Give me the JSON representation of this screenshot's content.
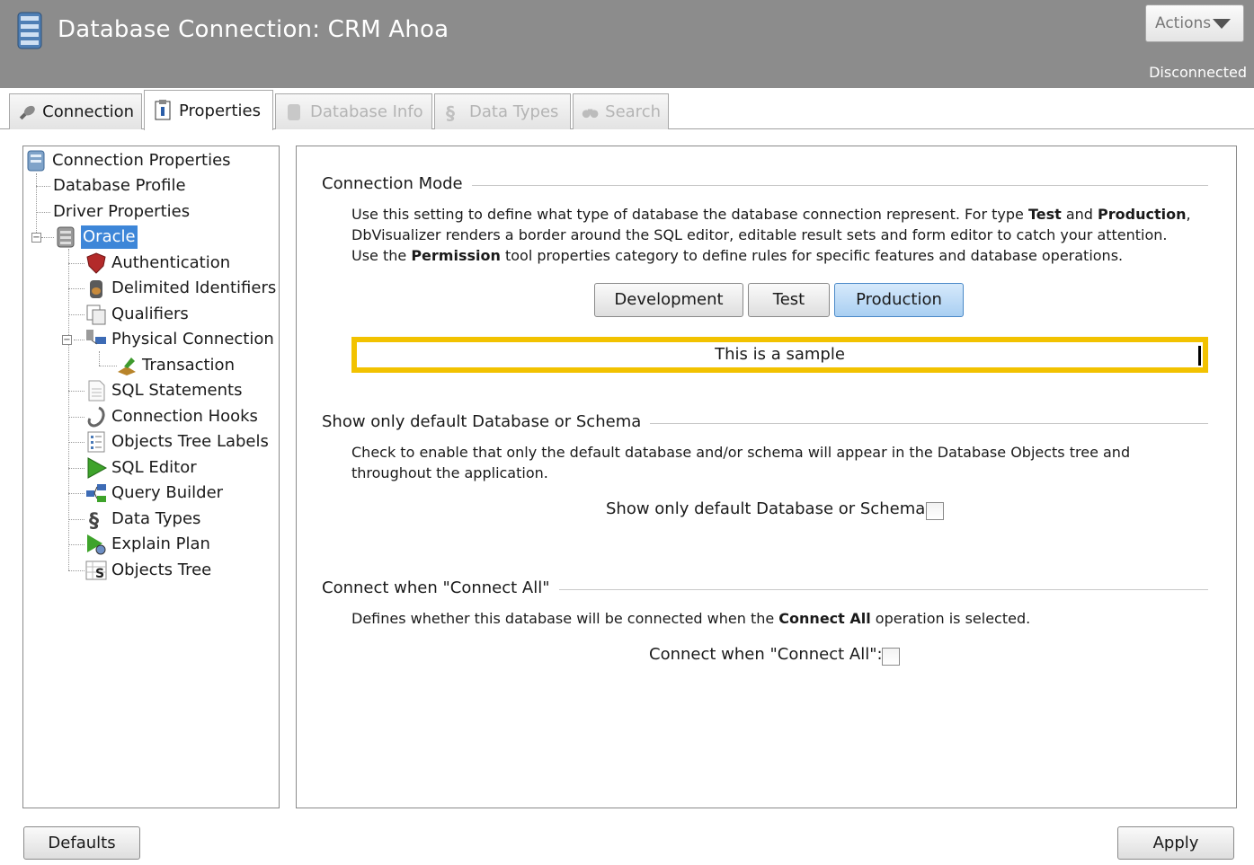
{
  "header": {
    "title": "Database Connection: CRM Ahoa",
    "actions_label": "Actions",
    "status": "Disconnected"
  },
  "tabs": [
    {
      "label": "Connection",
      "icon": "plug-icon",
      "state": "normal"
    },
    {
      "label": "Properties",
      "icon": "properties-icon",
      "state": "active"
    },
    {
      "label": "Database Info",
      "icon": "database-info-icon",
      "state": "disabled"
    },
    {
      "label": "Data Types",
      "icon": "data-types-icon",
      "state": "disabled"
    },
    {
      "label": "Search",
      "icon": "binoculars-icon",
      "state": "disabled"
    }
  ],
  "tree": {
    "root": "Connection Properties",
    "database_profile": "Database Profile",
    "driver_properties": "Driver Properties",
    "oracle": "Oracle",
    "authentication": "Authentication",
    "delimited_identifiers": "Delimited Identifiers",
    "qualifiers": "Qualifiers",
    "physical_connection": "Physical Connection",
    "transaction": "Transaction",
    "sql_statements": "SQL Statements",
    "connection_hooks": "Connection Hooks",
    "objects_tree_labels": "Objects Tree Labels",
    "sql_editor": "SQL Editor",
    "query_builder": "Query Builder",
    "data_types": "Data Types",
    "explain_plan": "Explain Plan",
    "objects_tree": "Objects Tree"
  },
  "connection_mode": {
    "title": "Connection Mode",
    "desc_1a": "Use this setting to define what type of database the database connection represent. For type ",
    "desc_1b": "Test",
    "desc_1c": " and ",
    "desc_1d": "Production",
    "desc_1e": ",",
    "desc_2": "DbVisualizer renders a border around the SQL editor, editable result sets and form editor to catch your attention.",
    "desc_3a": "Use the ",
    "desc_3b": "Permission",
    "desc_3c": " tool properties category to define rules for specific features and database operations.",
    "buttons": [
      "Development",
      "Test",
      "Production"
    ],
    "selected": "Production",
    "sample_text": "This is a sample"
  },
  "show_default": {
    "title": "Show only default Database or Schema",
    "desc": "Check to enable that only the default database and/or schema will appear in the Database Objects tree and throughout the application.",
    "checkbox_label": "Show only default Database or Schema:",
    "checked": false
  },
  "connect_all": {
    "title": "Connect when \"Connect All\"",
    "desc_a": "Defines whether this database will be connected when the ",
    "desc_b": "Connect All",
    "desc_c": " operation is selected.",
    "checkbox_label": "Connect when \"Connect All\":",
    "checked": false
  },
  "footer": {
    "defaults_label": "Defaults",
    "apply_label": "Apply"
  },
  "colors": {
    "header_bg": "#8c8c8c",
    "selection": "#3d86d8",
    "sample_border": "#f2c200"
  }
}
